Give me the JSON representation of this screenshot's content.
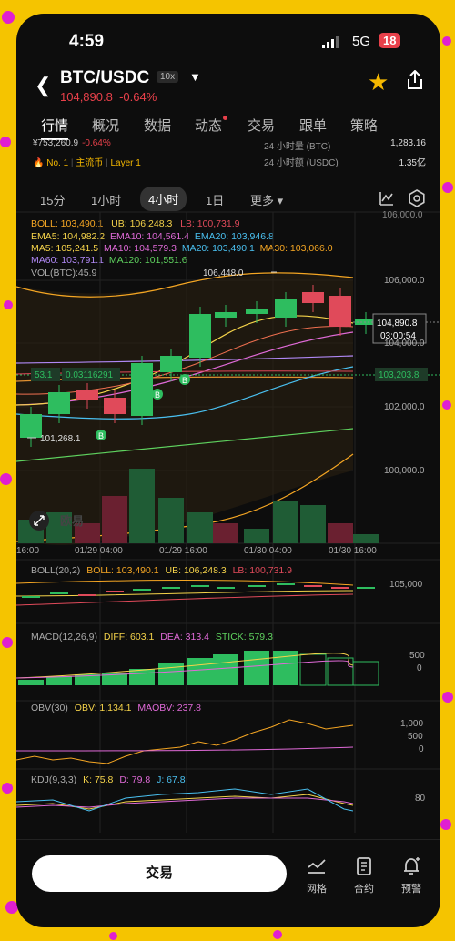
{
  "status": {
    "time": "4:59",
    "network": "5G",
    "battery": "18"
  },
  "header": {
    "pair": "BTC/USDC",
    "leverage": "10x",
    "price": "104,890.8",
    "change": "-0.64%"
  },
  "tabs": [
    {
      "label": "行情",
      "active": true,
      "dot": false
    },
    {
      "label": "概况",
      "active": false,
      "dot": false
    },
    {
      "label": "数据",
      "active": false,
      "dot": false
    },
    {
      "label": "动态",
      "active": false,
      "dot": true
    },
    {
      "label": "交易",
      "active": false,
      "dot": false
    },
    {
      "label": "跟单",
      "active": false,
      "dot": false
    },
    {
      "label": "策略",
      "active": false,
      "dot": false
    }
  ],
  "info": {
    "left_value": "¥753,260.9",
    "left_change": "-0.64%",
    "rank": "No. 1",
    "tag1": "主流币",
    "tag2": "Layer 1",
    "vol_label": "24 小时量 (BTC)",
    "vol_value": "1,283.16",
    "amt_label": "24 小时额 (USDC)",
    "amt_value": "1.35亿"
  },
  "intervals": [
    "15分",
    "1小时",
    "4小时",
    "1日",
    "更多"
  ],
  "active_interval": "4小时",
  "indicators": {
    "boll": "BOLL: 103,490.1",
    "ub": "UB: 106,248.3",
    "lb": "LB: 100,731.9",
    "ema5": "EMA5: 104,982.2",
    "ema10": "EMA10: 104,561.4",
    "ema20": "EMA20: 103,946.8",
    "ma5": "MA5: 105,241.5",
    "ma10": "MA10: 104,579.3",
    "ma20": "MA20: 103,490.1",
    "ma30": "MA30: 103,066.0",
    "ma60": "MA60: 103,791.1",
    "ma120": "MA120: 101,551.6",
    "vol": "VOL(BTC):45.9"
  },
  "main_chart": {
    "high_label": "106,448.0",
    "low_label": "101,268.1",
    "last_price": "104,890.8",
    "countdown": "03:00:54",
    "dashed_price": "103,203.8",
    "tag_left": "53.1",
    "tag_value": "0.03116291",
    "y_ticks": [
      "106,000.0",
      "104,000.0",
      "102,000.0",
      "100,000.0"
    ],
    "top_tick": "106,000.0",
    "x_ticks": [
      "16:00",
      "01/29 04:00",
      "01/29 16:00",
      "01/30 04:00",
      "01/30 16:00"
    ],
    "buy_marker": "B",
    "watermark": "欧易"
  },
  "sub_boll": {
    "title": "BOLL(20,2)",
    "boll": "BOLL: 103,490.1",
    "ub": "UB: 106,248.3",
    "lb": "LB: 100,731.9",
    "tick": "105,000"
  },
  "macd": {
    "title": "MACD(12,26,9)",
    "diff": "DIFF: 603.1",
    "dea": "DEA: 313.4",
    "stick": "STICK: 579.3",
    "ticks": [
      "500",
      "0"
    ]
  },
  "obv": {
    "title": "OBV(30)",
    "obv": "OBV: 1,134.1",
    "maobv": "MAOBV: 237.8",
    "ticks": [
      "1,000",
      "500",
      "0"
    ]
  },
  "kdj": {
    "title": "KDJ(9,3,3)",
    "k": "K: 75.8",
    "d": "D: 79.8",
    "j": "J: 67.8",
    "tick": "80"
  },
  "bottom": {
    "trade": "交易",
    "grid": "网格",
    "contract": "合约",
    "alert": "预警"
  },
  "colors": {
    "up": "#2ebd5f",
    "down": "#e04a5a",
    "accent": "#f5c400",
    "dot": "#e01fd0"
  }
}
